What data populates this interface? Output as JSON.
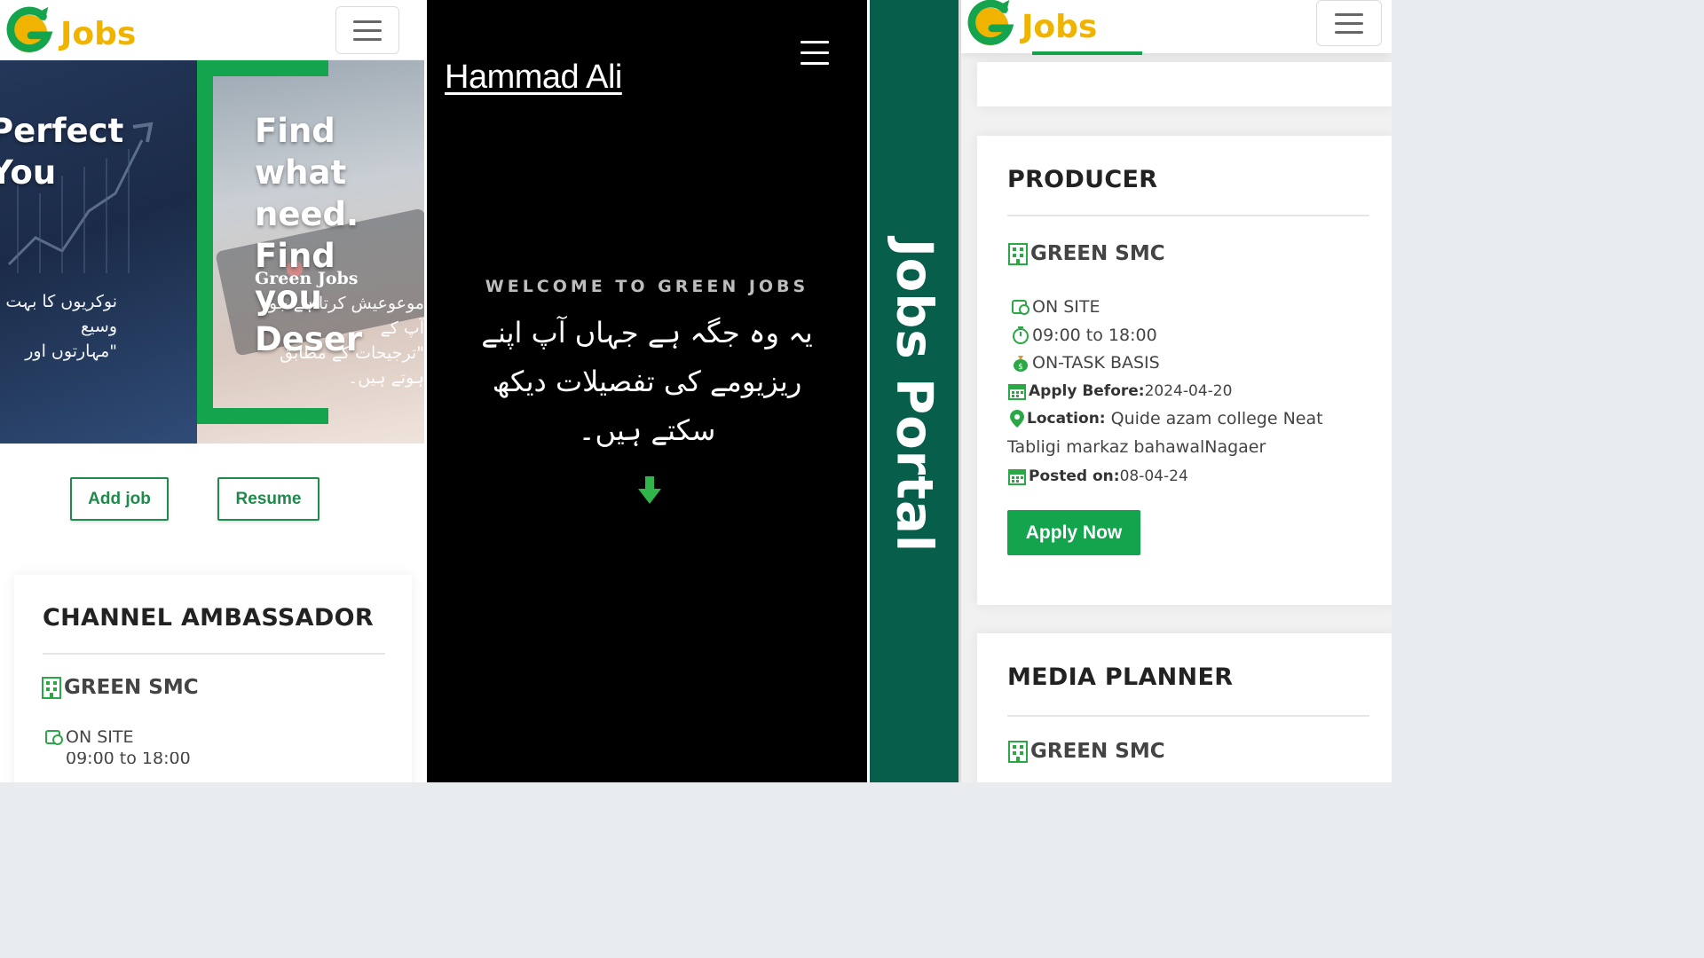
{
  "brand": {
    "logo_text": "Jobs",
    "colors": {
      "green": "#14a44d",
      "gold": "#f0b400",
      "teal": "#075e4b",
      "black": "#000000"
    }
  },
  "panel1": {
    "hero": {
      "left_title": "Perfect\nYou",
      "right_title": "Find what\nneed. Find\nyou Deser",
      "left_urdu": "نوکریوں کا بہت وسیع\n\"مہارتوں اور",
      "right_brand": "Green Jobs",
      "right_urdu": "موعوعیش کرتا ہے جو آپ کے\n\"ترجیحات کے مطابق ہوتے ہیں۔"
    },
    "buttons": {
      "add_job": "Add job",
      "resume": "Resume"
    },
    "job": {
      "title": "CHANNEL AMBASSADOR",
      "company": "GREEN SMC",
      "type": "ON SITE",
      "time": "09:00 to 18:00"
    }
  },
  "panel2": {
    "name": "Hammad Ali",
    "welcome": "WELCOME TO GREEN JOBS",
    "urdu": "یہ وہ جگہ ہے جہاں آپ اپنے ریزیومے کی تفصیلات دیکھ سکتے ہیں۔",
    "icons": {
      "menu": "menu-icon",
      "arrow": "arrow-down-icon"
    }
  },
  "panel3": {
    "label": "Jobs Portal"
  },
  "panel4": {
    "job1": {
      "title": "PRODUCER",
      "company": "GREEN SMC",
      "type": "ON SITE",
      "time": "09:00 to 18:00",
      "basis": "ON-TASK BASIS",
      "apply_label": "Apply Before:",
      "apply_date": "2024-04-20",
      "location_label": "Location:",
      "location_line1": "Quide azam college Neat",
      "location_line2": "Tabligi markaz bahawalNagaer",
      "posted_label": "Posted on:",
      "posted_date": "08-04-24",
      "apply_button": "Apply Now"
    },
    "job2": {
      "title": "MEDIA PLANNER",
      "company": "GREEN SMC"
    }
  }
}
